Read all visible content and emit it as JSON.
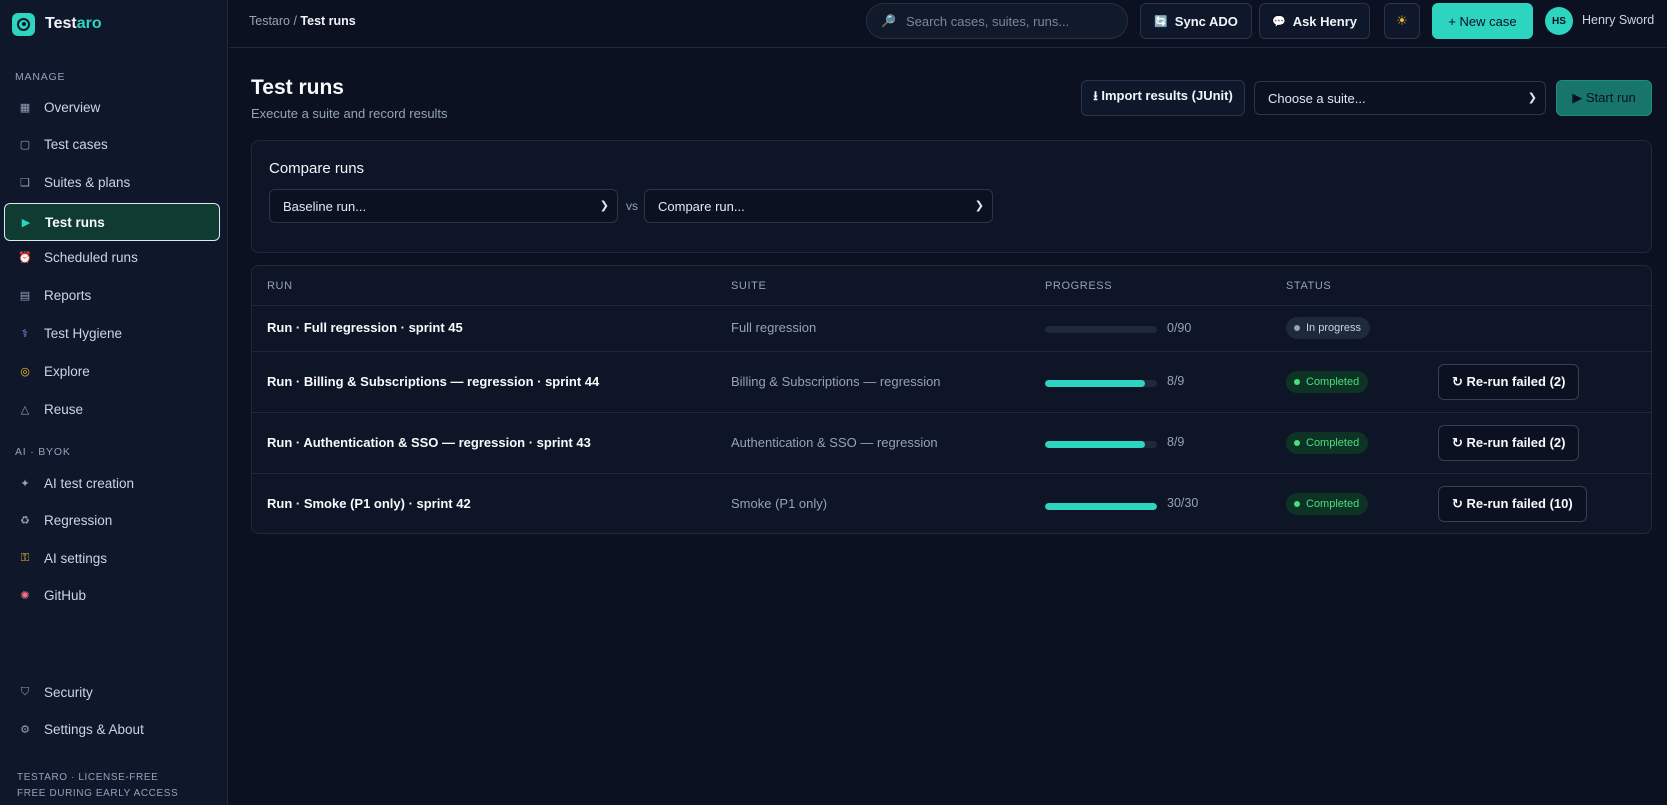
{
  "brand": {
    "name_start": "Test",
    "name_accent": "aro"
  },
  "sidebar": {
    "manage_label": "MANAGE",
    "ai_label": "AI · BYOK",
    "items": [
      {
        "label": "Overview",
        "icon": "grid-icon"
      },
      {
        "label": "Test cases",
        "icon": "square-icon"
      },
      {
        "label": "Suites & plans",
        "icon": "stack-icon"
      },
      {
        "label": "Test runs",
        "icon": "play-icon",
        "active": true
      },
      {
        "label": "Scheduled runs",
        "icon": "alarm-clock-icon"
      },
      {
        "label": "Reports",
        "icon": "list-icon"
      },
      {
        "label": "Test Hygiene",
        "icon": "stethoscope-icon"
      },
      {
        "label": "Explore",
        "icon": "compass-icon"
      },
      {
        "label": "Reuse",
        "icon": "triangle-icon"
      }
    ],
    "ai_items": [
      {
        "label": "AI test creation",
        "icon": "sparkle-icon"
      },
      {
        "label": "Regression",
        "icon": "recycle-icon"
      },
      {
        "label": "AI settings",
        "icon": "key-icon"
      },
      {
        "label": "GitHub",
        "icon": "octopus-icon"
      }
    ],
    "bottom_items": [
      {
        "label": "Security",
        "icon": "shield-icon"
      },
      {
        "label": "Settings & About",
        "icon": "gear-icon"
      }
    ],
    "footer_line1": "TESTARO · LICENSE-FREE",
    "footer_line2": "FREE DURING EARLY ACCESS"
  },
  "topbar": {
    "breadcrumb_root": "Testaro / ",
    "breadcrumb_current": "Test runs",
    "search_placeholder": "Search cases, suites, runs...",
    "sync_label": "Sync ADO",
    "ask_label": "Ask Henry",
    "new_case_label": "+ New case",
    "avatar_initials": "HS",
    "user_name": "Henry Sword"
  },
  "page": {
    "title": "Test runs",
    "subtitle": "Execute a suite and record results",
    "import_label": "⭳ Import results (JUnit)",
    "suite_select": "Choose a suite...",
    "start_label": "▶ Start run"
  },
  "compare": {
    "title": "Compare runs",
    "baseline": "Baseline run...",
    "vs": "vs",
    "compare": "Compare run..."
  },
  "table": {
    "headers": [
      "RUN",
      "SUITE",
      "PROGRESS",
      "STATUS"
    ],
    "rows": [
      {
        "run": "Run · Full regression · sprint 45",
        "suite": "Full regression",
        "progress": 0.0,
        "count": "0/90",
        "status": "In progress",
        "rerun": ""
      },
      {
        "run": "Run · Billing & Subscriptions — regression · sprint 44",
        "suite": "Billing & Subscriptions — regression",
        "progress": 0.889,
        "count": "8/9",
        "status": "Completed",
        "rerun": "↻ Re-run failed (2)"
      },
      {
        "run": "Run · Authentication & SSO — regression · sprint 43",
        "suite": "Authentication & SSO — regression",
        "progress": 0.889,
        "count": "8/9",
        "status": "Completed",
        "rerun": "↻ Re-run failed (2)"
      },
      {
        "run": "Run · Smoke (P1 only) · sprint 42",
        "suite": "Smoke (P1 only)",
        "progress": 1.0,
        "count": "30/30",
        "status": "Completed",
        "rerun": "↻ Re-run failed (10)"
      }
    ]
  },
  "colors": {
    "accent": "#2dd4bf",
    "background": "#0b1120",
    "completed": "#4ade80"
  }
}
